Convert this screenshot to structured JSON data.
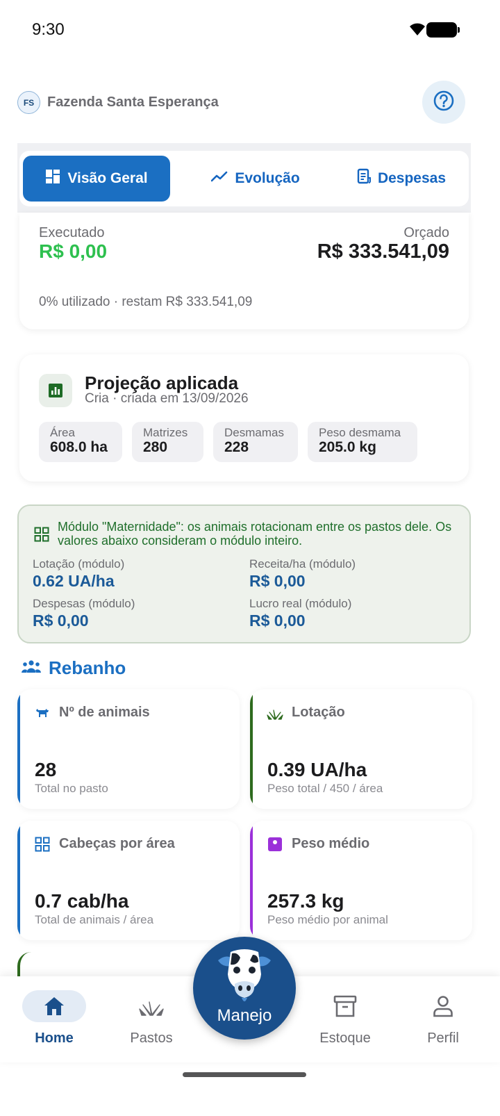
{
  "status": {
    "time": "9:30"
  },
  "header": {
    "avatar_initials": "FS",
    "farm_name": "Fazenda Santa Esperança"
  },
  "tabs": [
    {
      "label": "Visão Geral",
      "icon": "dashboard-icon",
      "active": true
    },
    {
      "label": "Evolução",
      "icon": "trending-up-icon",
      "active": false
    },
    {
      "label": "Despesas",
      "icon": "receipt-icon",
      "active": false
    }
  ],
  "budget": {
    "executed_label": "Executado",
    "executed_value": "R$ 0,00",
    "budget_label": "Orçado",
    "budget_value": "R$ 333.541,09",
    "usage_text": "0% utilizado · restam R$ 333.541,09"
  },
  "projection": {
    "title": "Projeção aplicada",
    "subtitle": "Cria · criada em 13/09/2026",
    "chips": [
      {
        "label": "Área",
        "value": "608.0 ha"
      },
      {
        "label": "Matrizes",
        "value": "280"
      },
      {
        "label": "Desmamas",
        "value": "228"
      },
      {
        "label": "Peso desmama",
        "value": "205.0 kg"
      }
    ]
  },
  "module": {
    "text": "Módulo \"Maternidade\": os animais rotacionam entre os pastos dele. Os valores abaixo consideram o módulo inteiro.",
    "stats": [
      {
        "label": "Lotação (módulo)",
        "value": "0.62 UA/ha"
      },
      {
        "label": "Receita/ha (módulo)",
        "value": "R$ 0,00"
      },
      {
        "label": "Despesas (módulo)",
        "value": "R$ 0,00"
      },
      {
        "label": "Lucro real (módulo)",
        "value": "R$ 0,00"
      }
    ]
  },
  "herd": {
    "title": "Rebanho",
    "cards": [
      {
        "title": "Nº de animais",
        "value": "28",
        "sub": "Total no pasto",
        "icon": "cattle-icon",
        "accent": "#1b6fc2"
      },
      {
        "title": "Lotação",
        "value": "0.39 UA/ha",
        "sub": "Peso total / 450 / área",
        "icon": "grass-icon",
        "accent": "#2e6b1e"
      },
      {
        "title": "Cabeças por área",
        "value": "0.7 cab/ha",
        "sub": "Total de animais / área",
        "icon": "grid-icon",
        "accent": "#1b6fc2"
      },
      {
        "title": "Peso médio",
        "value": "257.3 kg",
        "sub": "Peso médio por animal",
        "icon": "scale-icon",
        "accent": "#9b30d9"
      }
    ]
  },
  "nav": {
    "items": [
      {
        "label": "Home",
        "icon": "home-icon",
        "active": true
      },
      {
        "label": "Pastos",
        "icon": "grass-icon",
        "active": false
      },
      {
        "label": "Estoque",
        "icon": "archive-icon",
        "active": false
      },
      {
        "label": "Perfil",
        "icon": "person-icon",
        "active": false
      }
    ],
    "fab_label": "Manejo"
  }
}
